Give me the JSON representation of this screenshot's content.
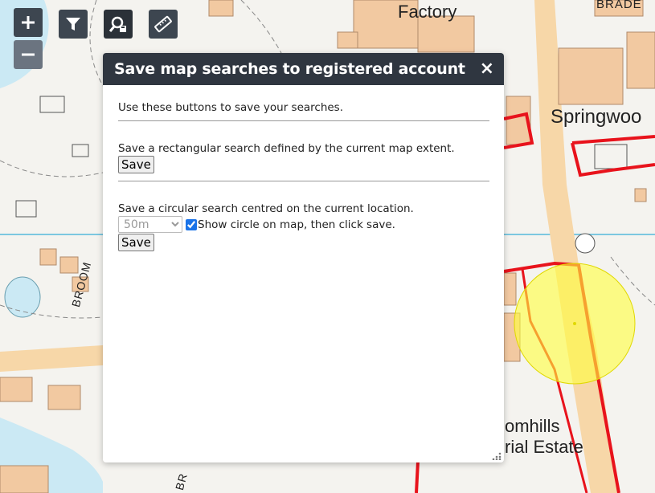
{
  "map": {
    "labels": {
      "factory": "Factory",
      "brade": "BRADE",
      "springwood": "Springwoo",
      "broom": "BROOM",
      "estate_line1": "omhills",
      "estate_line2": "rial Estate",
      "br": "BR"
    },
    "colors": {
      "building": "#f2c9a1",
      "boundary": "#e8131c",
      "water": "#cbe9f4",
      "search_circle": "#ffff3c"
    }
  },
  "toolbar": {
    "zoom_in_icon": "plus-icon",
    "zoom_out_icon": "minus-icon",
    "filter_icon": "filter-icon",
    "search_save_icon": "search-save-icon",
    "measure_icon": "ruler-icon"
  },
  "panel": {
    "title": "Save map searches to registered account",
    "close_glyph": "×",
    "intro": "Use these buttons to save your searches.",
    "rect_label": "Save a rectangular search defined by the current map extent.",
    "rect_save": "Save",
    "circle_label": "Save a circular search centred on the current location.",
    "radius_selected": "50m",
    "show_circle_label": "Show circle on map, then click save.",
    "show_circle_checked": true,
    "circle_save": "Save"
  }
}
